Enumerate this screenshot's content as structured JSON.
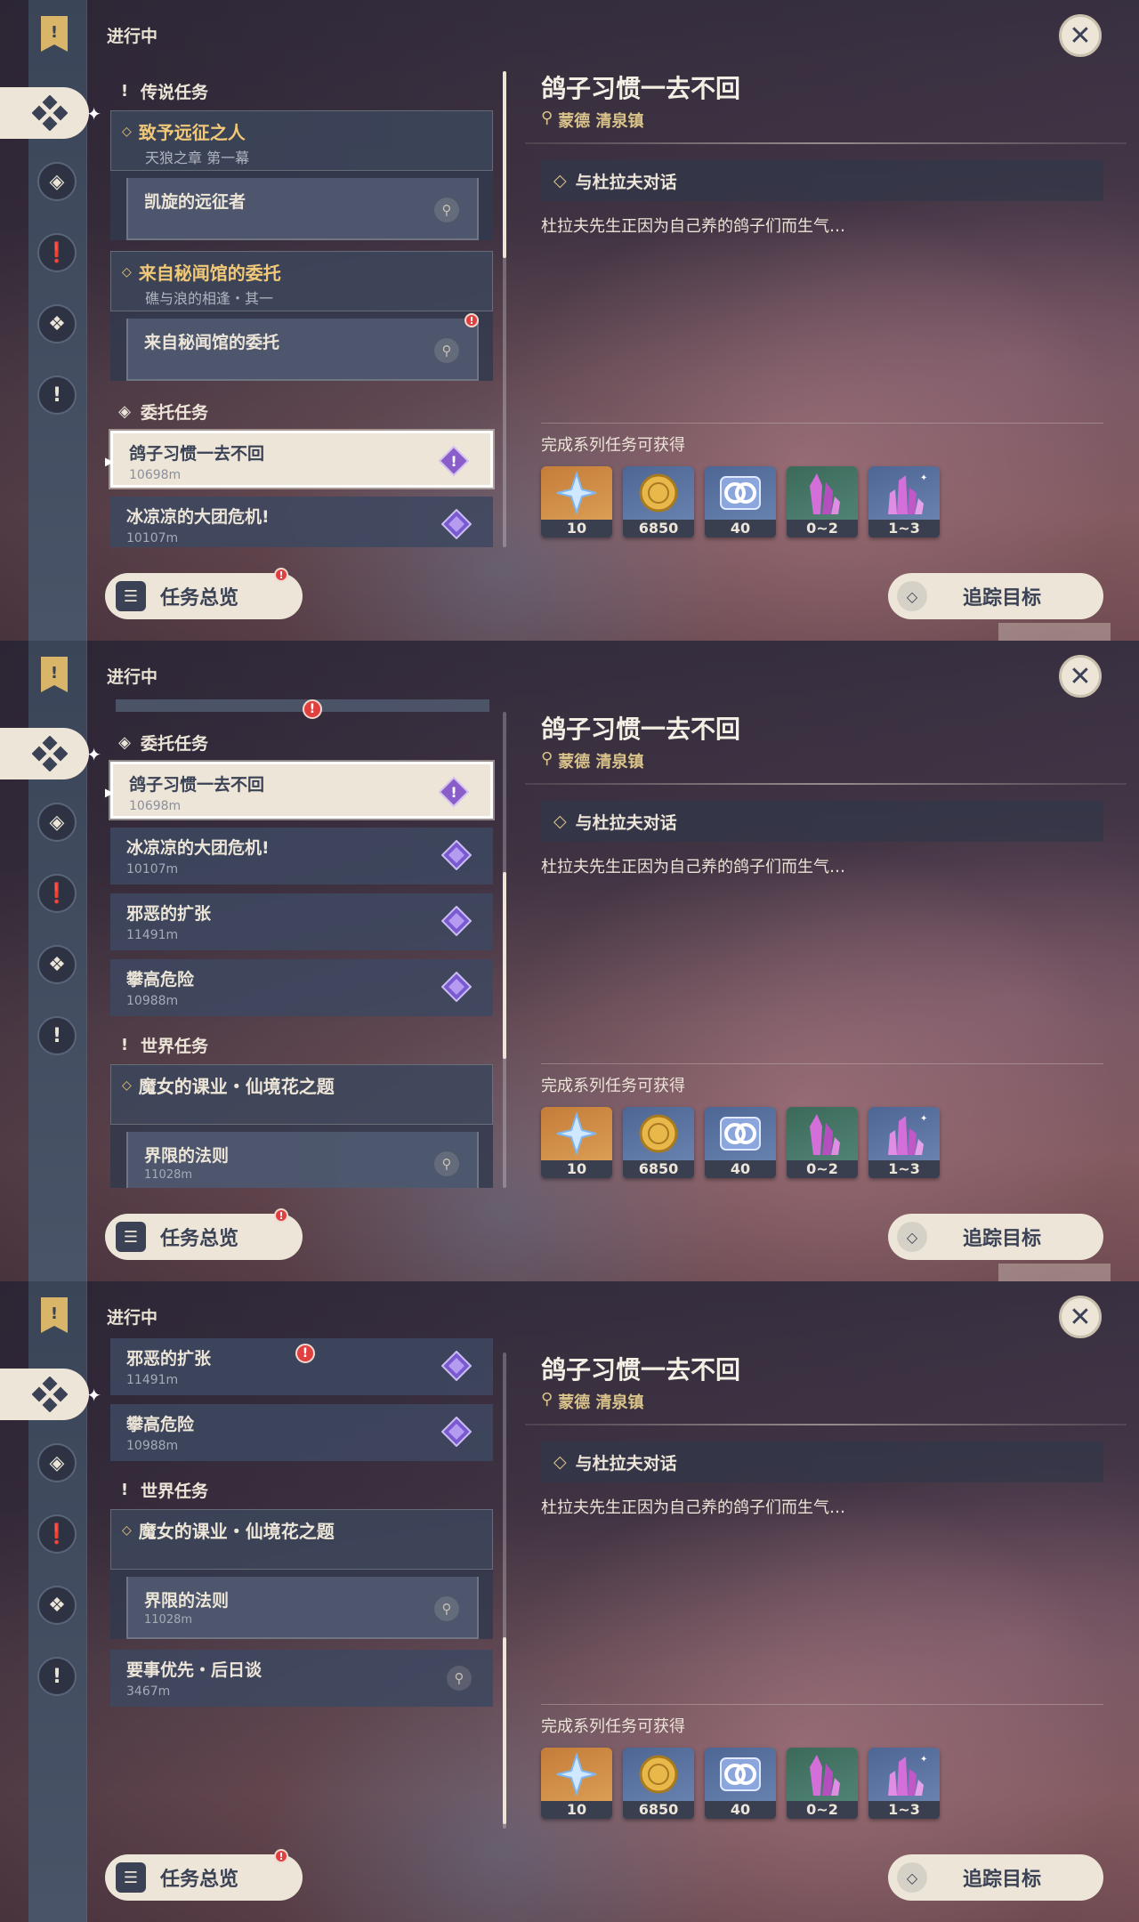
{
  "status": "进行中",
  "close_symbol": "✕",
  "buttons": {
    "overview": "任务总览",
    "track": "追踪目标"
  },
  "detail": {
    "title": "鸽子习惯一去不回",
    "location": "蒙德 清泉镇",
    "objective": "与杜拉夫对话",
    "description": "杜拉夫先生正因为自己养的鸽子们而生气…",
    "rewards_title": "完成系列任务可获得",
    "rewards": [
      {
        "icon": "primogem-icon",
        "count": "10"
      },
      {
        "icon": "mora-icon",
        "count": "6850"
      },
      {
        "icon": "adventure-exp-icon",
        "count": "40"
      },
      {
        "icon": "crystal-chunk-icon",
        "count": "0~2"
      },
      {
        "icon": "crystal-cluster-icon",
        "count": "1~3"
      }
    ]
  },
  "sections": {
    "legend": "传说任务",
    "commission": "委托任务",
    "world": "世界任务"
  },
  "legend_quest_1": {
    "title": "致予远征之人",
    "subtitle": "天狼之章 第一幕",
    "step": "凯旋的远征者"
  },
  "legend_quest_2": {
    "title": "来自秘闻馆的委托",
    "subtitle": "礁与浪的相逢・其一",
    "step": "来自秘闻馆的委托"
  },
  "commissions": [
    {
      "title": "鸽子习惯一去不回",
      "distance": "10698m"
    },
    {
      "title": "冰凉凉的大团危机!",
      "distance": "10107m"
    },
    {
      "title": "邪恶的扩张",
      "distance": "11491m"
    },
    {
      "title": "攀高危险",
      "distance": "10988m"
    }
  ],
  "world_quest": {
    "title": "魔女的课业・仙境花之题",
    "step": "界限的法则",
    "step_distance": "11028m"
  },
  "extra_quest": {
    "title": "要事优先・后日谈",
    "distance": "3467m"
  },
  "colors": {
    "accent": "#ece5d8",
    "gold": "#f0c878",
    "alert": "#e0403f"
  }
}
